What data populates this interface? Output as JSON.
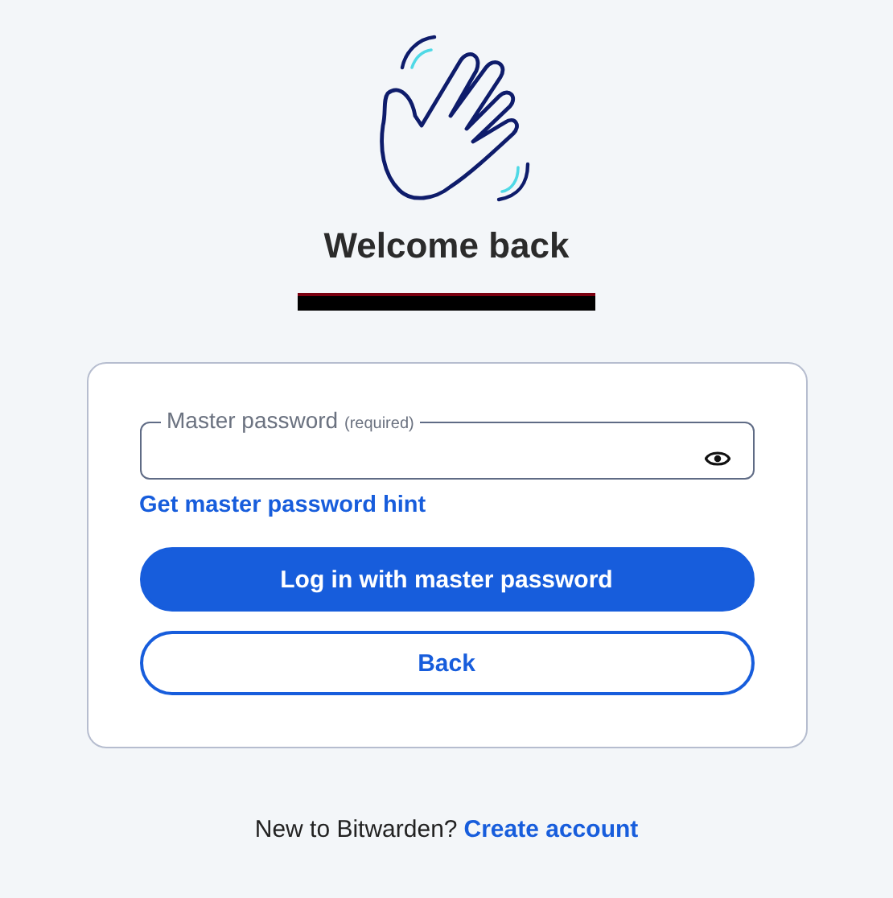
{
  "heading": "Welcome back",
  "email_redacted": true,
  "password_field": {
    "label": "Master password",
    "required_note": "(required)"
  },
  "hint_link": "Get master password hint",
  "buttons": [
    {
      "label": "Log in with master password",
      "kind": "primary"
    },
    {
      "label": "Back",
      "kind": "secondary"
    }
  ],
  "footer": {
    "text": "New to Bitwarden?",
    "link": "Create account"
  }
}
